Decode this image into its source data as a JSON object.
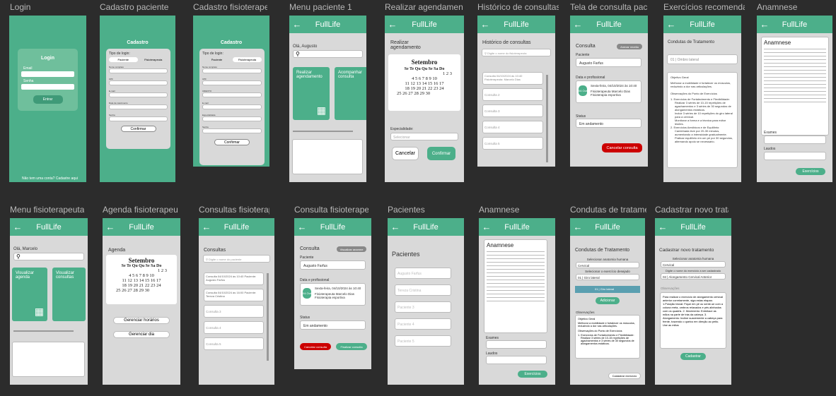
{
  "app": "FullLife",
  "frames_row1": [
    "Login",
    "Cadastro paciente",
    "Cadastro fisioterapeuta",
    "Menu paciente 1",
    "Realizar agendamento",
    "Histórico de consultas",
    "Tela de consulta paciente",
    "Exercícios recomendados",
    "Anamnese"
  ],
  "frames_row2": [
    "Menu fisioterapeuta",
    "Agenda fisioterapeuta",
    "Consultas fisioterapeuta",
    "Consulta fisioterapeuta",
    "Pacientes",
    "Anamnese",
    "Condutas de tratamento",
    "Cadastrar novo tratamento"
  ],
  "login": {
    "title": "Login",
    "email_lbl": "Email",
    "senha_lbl": "Senha",
    "btn": "Entrar",
    "footer": "Não tem uma conta? Cadastre aqui"
  },
  "cadastro": {
    "title": "Cadastro",
    "tipo": "Tipo de login:",
    "paciente": "Paciente",
    "fisio": "Fisioterapeuta",
    "nome": "Nome completo",
    "cpf": "CPF",
    "email": "E-mail",
    "data": "Data de nascimento",
    "senha": "Senha",
    "crefito": "CREFITO",
    "especialidade": "Especialidade",
    "confirmar": "Confirmar"
  },
  "menu_p": {
    "greeting": "Olá, Augusto",
    "card1": "Realizar agendamento",
    "card2": "Acompanhar consulta"
  },
  "agendar": {
    "title": "Realizar agendamento",
    "month": "Setembro",
    "weekdays": "Se Te Qu Qu Se Sa Do",
    "weeks": [
      "1 2 3",
      "4 5 6 7 8 9 10",
      "11 12 13 14 15 16 17",
      "18 19 20 21 22 23 24",
      "25 26 27 28 29 30"
    ],
    "esp": "Especialidade:",
    "sel": "Selecionar",
    "cancelar": "Cancelar",
    "confirmar": "Confirmar"
  },
  "historico": {
    "title": "Histórico de consultas",
    "search": "Digite o nome do fisioterapeuta",
    "items": [
      "Consulta 04/10/2024 às 10:40 Fisioterapeuta: Marcelo Dias",
      "Consulta 2",
      "Consulta 3",
      "Consulta 4",
      "Consulta 5"
    ]
  },
  "consulta": {
    "title": "Consulta",
    "anam": "Anexar receita",
    "paciente_lbl": "Paciente",
    "paciente": "Augusto Farfus",
    "data_lbl": "Data e profissional",
    "date_tag": "04 Out",
    "date": "Sexta-feira, 04/10/2024 às 10:40",
    "prof": "Fisioterapeuta Marcelo Dias Fisioterapia esportiva",
    "status_lbl": "Status",
    "status": "Em andamento",
    "cancelar": "Cancelar consulta",
    "finalizar": "Finalizar consulta",
    "visualizar": "Visualizar anamne"
  },
  "exercicios": {
    "title": "Condutas de Tratamento",
    "sel": "01 | Ombro lateral",
    "obj": "Objetivo Geral",
    "obj_text": "Melhorar a mobilidade e fortalecer os músculos, reduzindo a dor nas articulações.",
    "obs": "Observações do Ponto de Exercícios",
    "items": [
      "1. Exercícios de Fortalecimento e Flexibilidade:",
      "Realizar 3 séries de 10-15 repetições de agachamentos e 3 séries de 30 segundos de alongamentos estáticos.",
      "Incluir 3 séries de 10 repetições do giro lateral para a cervical.",
      "Monitorar a forma e a técnica para evitar lesões.",
      "2. Exercícios Aeróbicos e de Equilíbrio:",
      "Caminhada leve por 20-30 minutos, aumentando a intensidade gradualmente.",
      "Praticar equilíbrio em um pé por 30 segundos, alternando apoio se necessário."
    ]
  },
  "anamnese": {
    "title": "Anamnese",
    "exames": "Exames",
    "laudos": "Laudos",
    "btn": "Exercícios"
  },
  "menu_f": {
    "greeting": "Olá, Marcelo",
    "card1": "Visualizar agenda",
    "card2": "Visualizar consultas"
  },
  "agenda_f": {
    "title": "Agenda",
    "gerenciar": "Gerenciar horários",
    "dia": "Gerenciar dia"
  },
  "consultas_f": {
    "title": "Consultas",
    "search": "Digite o nome do paciente",
    "items": [
      "Consulta 04/10/2024 às 10:40 Paciente: Augusto Farfus",
      "Consulta 04/10/2024 às 16:00 Paciente: Tereza Cristina",
      "Consulta 3",
      "Consulta 4",
      "Consulta 5"
    ]
  },
  "pacientes": {
    "title": "Pacientes",
    "items": [
      "Augusto Farfus",
      "Tereza Cristina",
      "Paciente 3",
      "Paciente 4",
      "Paciente 5"
    ]
  },
  "condutas": {
    "title": "Condutas de Tratamento",
    "sel_label": "Selecionar anatomia humana",
    "sel": "Cervical",
    "ex_label": "Selecionar o exercício desejado",
    "ex": "01 | Giro lateral",
    "row": "01 | Giro lateral",
    "add": "Adicionar",
    "obs": "Observações",
    "cadastrar": "Cadastrar exercício"
  },
  "novo": {
    "title": "Cadastrar novo tratamento",
    "sel_label": "Selecionar anatomia humana",
    "sel": "Cervical",
    "ex_label": "Digite o nome do exercício a ser cadastrado",
    "ex": "02 | Alongamento Cervical Anterior",
    "obs": "Observações",
    "text": "Para realizar o exercício de alongamento cervical anterior corretamente, siga estas etapas: 1.Posição Inicial: Fique em pé ou sente-se com a coluna ereta, ombros relaxados e pés alinhados com os quadris. 2. Movimento: Entrelace as mãos na parte de trás da cabeça. 3. Alongamento: Incline suavemente a cabeça para frente, trazendo o queixo em direção ao peito. Use as mãos",
    "btn": "Cadastrar"
  }
}
